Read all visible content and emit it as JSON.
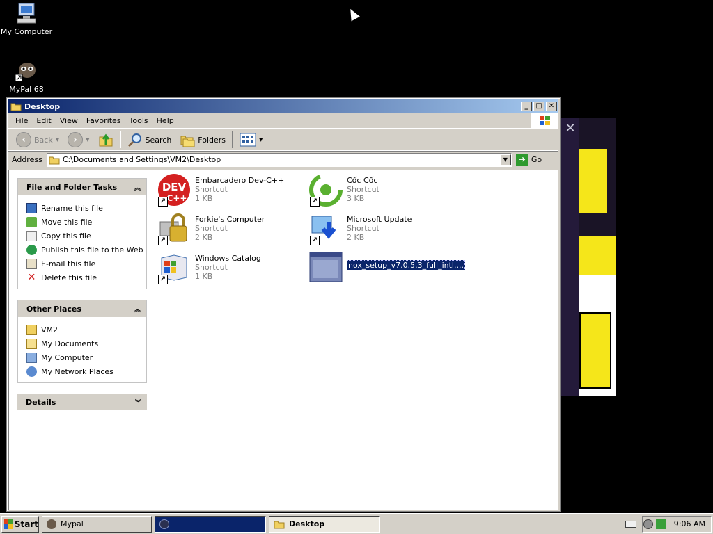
{
  "desktop": {
    "icons": [
      {
        "label": "My Computer",
        "icon": "my-computer-icon"
      },
      {
        "label": "MyPal 68",
        "icon": "mypal-icon"
      }
    ]
  },
  "window": {
    "title": "Desktop",
    "menu": [
      "File",
      "Edit",
      "View",
      "Favorites",
      "Tools",
      "Help"
    ],
    "toolbar": {
      "back": "Back",
      "search": "Search",
      "folders": "Folders"
    },
    "address": {
      "label": "Address",
      "value": "C:\\Documents and Settings\\VM2\\Desktop",
      "go": "Go"
    }
  },
  "tasks": {
    "file_folder": {
      "title": "File and Folder Tasks",
      "items": [
        "Rename this file",
        "Move this file",
        "Copy this file",
        "Publish this file to the Web",
        "E-mail this file",
        "Delete this file"
      ]
    },
    "other_places": {
      "title": "Other Places",
      "items": [
        "VM2",
        "My Documents",
        "My Computer",
        "My Network Places"
      ]
    },
    "details": {
      "title": "Details"
    }
  },
  "files": [
    {
      "name": "Embarcadero Dev-C++",
      "type": "Shortcut",
      "size": "1 KB",
      "icon": "devcpp-icon"
    },
    {
      "name": "Cốc Cốc",
      "type": "Shortcut",
      "size": "3 KB",
      "icon": "coccoc-icon"
    },
    {
      "name": "Forkie's Computer",
      "type": "Shortcut",
      "size": "2 KB",
      "icon": "lock-computer-icon"
    },
    {
      "name": "Microsoft Update",
      "type": "Shortcut",
      "size": "2 KB",
      "icon": "microsoft-update-icon"
    },
    {
      "name": "Windows Catalog",
      "type": "Shortcut",
      "size": "1 KB",
      "icon": "windows-catalog-icon"
    },
    {
      "name": "nox_setup_v7.0.5.3_full_intl....",
      "icon": "installer-window-icon"
    }
  ],
  "taskbar": {
    "start": "Start",
    "tasks": [
      "Mypal",
      "",
      "Desktop"
    ],
    "clock": "9:06 AM"
  },
  "colors": {
    "titlebar": "#0a246a",
    "selection": "#0a246a",
    "desktop": "#000000"
  }
}
